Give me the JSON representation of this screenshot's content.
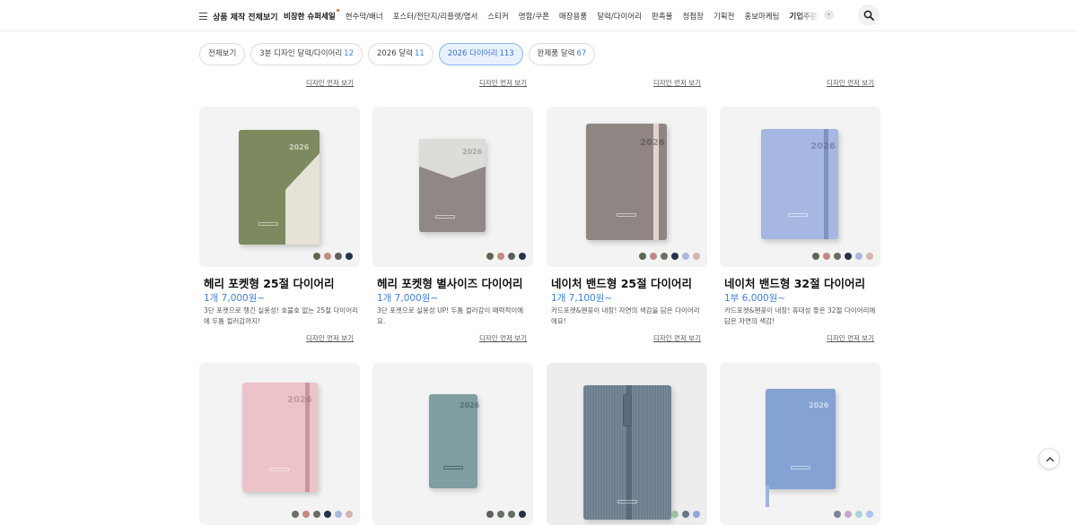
{
  "nav": {
    "all_label": "상품 제작 전체보기",
    "items": [
      {
        "label": "비장한 슈퍼세일",
        "bold": true,
        "dot": true
      },
      {
        "label": "현수막/배너"
      },
      {
        "label": "포스터/전단지/리플렛/엽서"
      },
      {
        "label": "스티커"
      },
      {
        "label": "명함/쿠폰"
      },
      {
        "label": "매장용품"
      },
      {
        "label": "달력/다이어리"
      },
      {
        "label": "판촉물"
      },
      {
        "label": "청첩장"
      },
      {
        "label": "기획전"
      },
      {
        "label": "홍보마케팅"
      },
      {
        "label": "기업주문",
        "bold": true
      }
    ],
    "next_icon": "chevron-right-icon",
    "search_icon": "search-icon"
  },
  "chips": [
    {
      "label": "전체보기",
      "count": ""
    },
    {
      "label": "3분 디자인 달력/다이어리",
      "count": "12"
    },
    {
      "label": "2026 달력",
      "count": "11"
    },
    {
      "label": "2026 다이어리",
      "count": "113",
      "active": true
    },
    {
      "label": "완제품 달력",
      "count": "67"
    }
  ],
  "design_link": "디자인 먼저 보기",
  "products": [
    {
      "name": "헤리 포켓형 25절 다이어리",
      "price": "1개 7,000원~",
      "desc": "3단 포켓으로 챙긴 실용성! 호불호 없는 25절 다이어리에 두툼 컬러감까지!",
      "swatches": [
        "#5d6653",
        "#c28b82",
        "#5e5e5e",
        "#263247"
      ]
    },
    {
      "name": "헤리 포켓형 별사이즈 다이어리",
      "price": "1개 7,000원~",
      "desc": "3단 포켓으로 실용성 UP! 두툼 컬러감이 매력적이에요.",
      "swatches": [
        "#5d6653",
        "#c28b82",
        "#5e5e5e",
        "#263247"
      ]
    },
    {
      "name": "네이처 밴드형 25절 다이어리",
      "price": "1개 7,100원~",
      "desc": "카드포켓&펜꽂이 내장! 자연의 색감을 담은 다이어리에요!",
      "swatches": [
        "#5d6653",
        "#c28b82",
        "#6b7065",
        "#263247",
        "#a8b8dd",
        "#d9b3b0"
      ]
    },
    {
      "name": "네이처 밴드형 32절 다이어리",
      "price": "1부 6,000원~",
      "desc": "카드포켓&펜꽂이 내장! 휴대성 좋은 32절 다이어리에 담은 자연의 색감!",
      "swatches": [
        "#5d6653",
        "#c28b82",
        "#6b7065",
        "#263247",
        "#a8b8dd",
        "#d9b3b0"
      ]
    }
  ],
  "row2_swatches": [
    [
      "#6b7065",
      "#c28b82",
      "#6b6b6b",
      "#263247",
      "#a8b8dd",
      "#d9b3b0"
    ],
    [
      "#5e5e5e",
      "#6b7065",
      "#5e6f66",
      "#263247"
    ],
    [
      "#9cbf9f",
      "#66788a",
      "#8fa8d8"
    ],
    [
      "#7d8592",
      "#c8a6cf",
      "#a9d3d8",
      "#a8c6ec"
    ]
  ],
  "book_year": "2026",
  "to_top_icon": "arrow-up-icon"
}
